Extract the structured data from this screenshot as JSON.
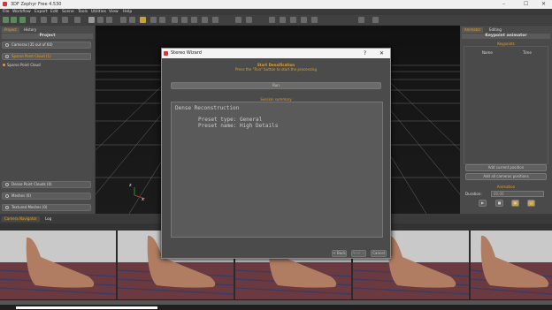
{
  "titlebar": {
    "title": "3DF Zephyr Free 4.530"
  },
  "menu": [
    "File",
    "Workflow",
    "Export",
    "Edit",
    "Scene",
    "Tools",
    "Utilities",
    "View",
    "Help"
  ],
  "left_panel": {
    "tabs": [
      "Project",
      "History"
    ],
    "header": "Project",
    "items": [
      "Cameras (35 out of 60)",
      "Sparse Point Cloud (1)",
      "Sparse Point Cloud"
    ],
    "bottom_items": [
      "Dense Point Clouds (0)",
      "Meshes (0)",
      "Textured Meshes (0)"
    ]
  },
  "right_panel": {
    "tabs": [
      "Animator",
      "Editing"
    ],
    "header": "Keypoint animator",
    "section": "Keypoints",
    "columns": [
      "Name",
      "Time"
    ],
    "buttons": [
      "Add current position",
      "Add all cameras positions"
    ],
    "animation_label": "Animation",
    "duration_label": "Duration:",
    "duration_value": "00:00"
  },
  "bottom_tabs": [
    "Camera Navigator",
    "Log"
  ],
  "dialog": {
    "title": "Stereo Wizard",
    "help": "?",
    "close": "✕",
    "section_title": "Start Densification",
    "instruction": "Press the \"Run\" button to start the processing",
    "run_label": "Run",
    "summary_title": "Session summary",
    "summary_lines": [
      "Dense Reconstruction",
      "Preset type: General",
      "Preset name: High Details"
    ],
    "back": "< Back",
    "next": "Next >",
    "cancel": "Cancel"
  },
  "viewport": {
    "axis_x": "x",
    "axis_z": "z"
  }
}
